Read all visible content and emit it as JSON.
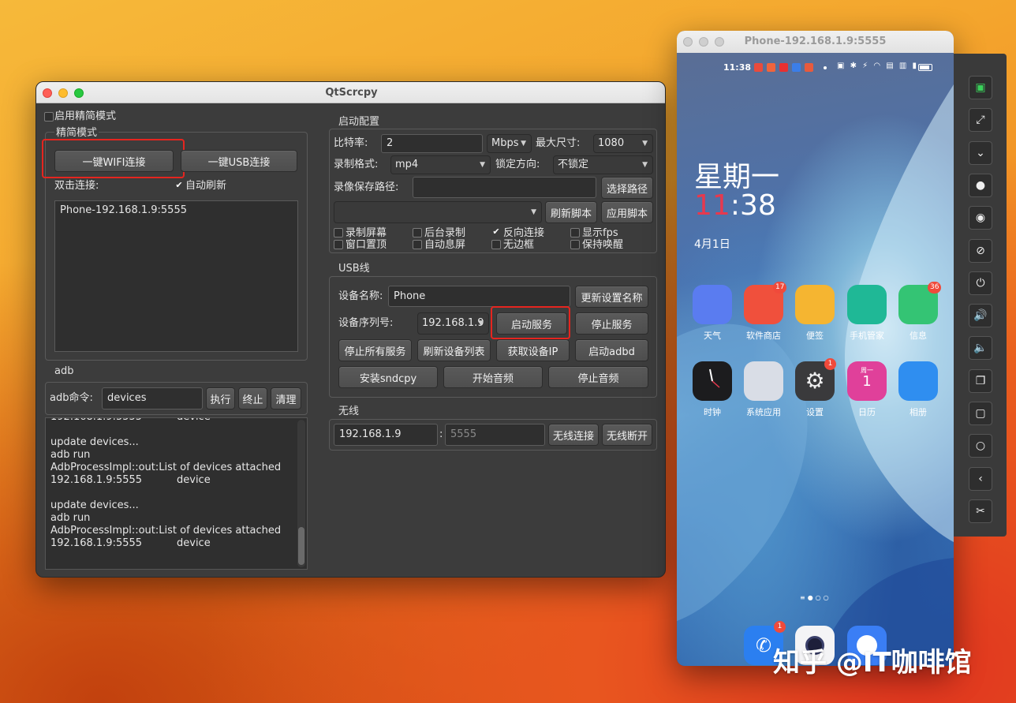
{
  "qtscrcpy": {
    "title": "QtScrcpy",
    "simple_mode": {
      "enable_checkbox_label": "启用精简模式",
      "group_title": "精简模式",
      "wifi_connect_button": "一键WIFI连接",
      "usb_connect_button": "一键USB连接",
      "double_click_label": "双击连接:",
      "auto_refresh_label": "自动刷新",
      "auto_refresh_checked": true,
      "devices": [
        "Phone-192.168.1.9:5555"
      ]
    },
    "adb": {
      "group_title": "adb",
      "command_label": "adb命令:",
      "command_value": "devices",
      "execute_button": "执行",
      "terminate_button": "终止",
      "clear_button": "清理",
      "log_lines": [
        {
          "a": "192.168.1.9:5555",
          "b": "device"
        },
        {
          "a": "",
          "b": ""
        },
        {
          "a": "update devices...",
          "b": ""
        },
        {
          "a": "adb run",
          "b": ""
        },
        {
          "a": "AdbProcessImpl::out:List of devices attached",
          "b": ""
        },
        {
          "a": "192.168.1.9:5555",
          "b": "device"
        },
        {
          "a": "",
          "b": ""
        },
        {
          "a": "update devices...",
          "b": ""
        },
        {
          "a": "adb run",
          "b": ""
        },
        {
          "a": "AdbProcessImpl::out:List of devices attached",
          "b": ""
        },
        {
          "a": "192.168.1.9:5555",
          "b": "device"
        }
      ]
    },
    "start_config": {
      "group_title": "启动配置",
      "bitrate_label": "比特率:",
      "bitrate_value": "2",
      "bitrate_unit": "Mbps",
      "max_size_label": "最大尺寸:",
      "max_size_value": "1080",
      "record_format_label": "录制格式:",
      "record_format_value": "mp4",
      "lock_orientation_label": "锁定方向:",
      "lock_orientation_value": "不锁定",
      "record_path_label": "录像保存路径:",
      "record_path_value": "",
      "select_path_button": "选择路径",
      "script_select_value": "",
      "refresh_script_button": "刷新脚本",
      "apply_script_button": "应用脚本",
      "options": [
        {
          "label": "录制屏幕",
          "checked": false
        },
        {
          "label": "后台录制",
          "checked": false
        },
        {
          "label": "反向连接",
          "checked": true
        },
        {
          "label": "显示fps",
          "checked": false
        },
        {
          "label": "窗口置顶",
          "checked": false
        },
        {
          "label": "自动息屏",
          "checked": false
        },
        {
          "label": "无边框",
          "checked": false
        },
        {
          "label": "保持唤醒",
          "checked": false
        }
      ]
    },
    "usb": {
      "group_title": "USB线",
      "device_name_label": "设备名称:",
      "device_name_value": "Phone",
      "update_name_button": "更新设置名称",
      "serial_label": "设备序列号:",
      "serial_value": "192.168.1.9",
      "start_service_button": "启动服务",
      "stop_service_button": "停止服务",
      "stop_all_button": "停止所有服务",
      "refresh_devices_button": "刷新设备列表",
      "get_ip_button": "获取设备IP",
      "start_adbd_button": "启动adbd",
      "install_sndcpy_button": "安装sndcpy",
      "start_audio_button": "开始音频",
      "stop_audio_button": "停止音频"
    },
    "wireless": {
      "group_title": "无线",
      "ip_value": "192.168.1.9",
      "port_separator": ":",
      "port_placeholder": "5555",
      "connect_button": "无线连接",
      "disconnect_button": "无线断开"
    }
  },
  "phone": {
    "title": "Phone-192.168.1.9:5555",
    "status_time": "11:38",
    "weekday": "星期一",
    "clock_hour": "11",
    "clock_rest": ":38",
    "date": "4月1日",
    "row1": [
      {
        "label": "天气",
        "icon": "weather-icon",
        "color": "#5a7cf0",
        "badge": ""
      },
      {
        "label": "软件商店",
        "icon": "app-store-icon",
        "color": "#f0503c",
        "badge": "17"
      },
      {
        "label": "便签",
        "icon": "notes-icon",
        "color": "#f5b531",
        "badge": ""
      },
      {
        "label": "手机管家",
        "icon": "phone-manager-icon",
        "color": "#1fb896",
        "badge": ""
      },
      {
        "label": "信息",
        "icon": "messages-icon",
        "color": "#34c474",
        "badge": "36"
      }
    ],
    "row2": [
      {
        "label": "时钟",
        "icon": "clock-icon",
        "color": "#1c1c1e",
        "badge": ""
      },
      {
        "label": "系统应用",
        "icon": "system-apps-folder-icon",
        "color": "#d9dde6",
        "badge": ""
      },
      {
        "label": "设置",
        "icon": "settings-icon",
        "color": "#3a3a3c",
        "badge": "1"
      },
      {
        "label": "日历",
        "icon": "calendar-icon",
        "color": "#e0409a",
        "badge": ""
      },
      {
        "label": "相册",
        "icon": "gallery-icon",
        "color": "#2f8ef0",
        "badge": ""
      }
    ],
    "calendar_day": "1",
    "calendar_weekday": "周一",
    "dock": [
      {
        "icon": "phone-dialer-icon",
        "color": "#2b7ff0",
        "badge": "1"
      },
      {
        "icon": "camera-icon",
        "color": "#f4f4f6",
        "badge": ""
      },
      {
        "icon": "browser-icon",
        "color": "#3a7ef5",
        "badge": ""
      }
    ]
  },
  "sidebar_tools": [
    "phone-icon",
    "fullscreen-icon",
    "expand-notification-icon",
    "touch-dot-icon",
    "show-eye-icon",
    "hide-eye-icon",
    "power-icon",
    "volume-up-icon",
    "volume-down-icon",
    "app-switch-icon",
    "home-icon",
    "circle-icon",
    "back-icon",
    "screenshot-icon"
  ],
  "watermark": "知乎 @IT咖啡馆"
}
